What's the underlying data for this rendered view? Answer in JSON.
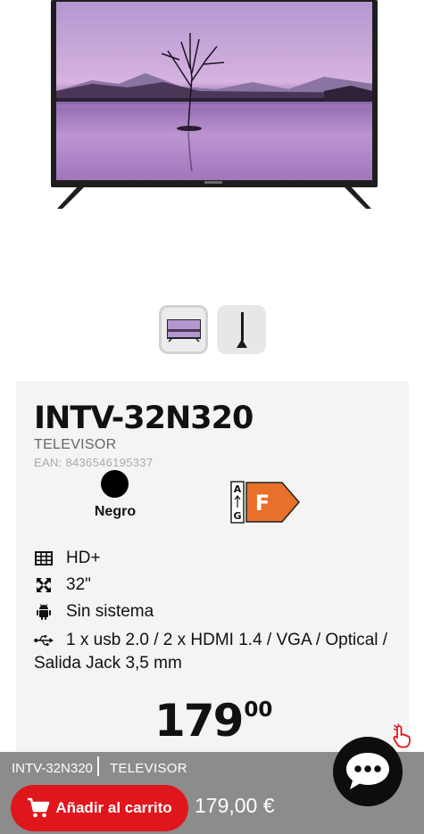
{
  "product": {
    "model": "INTV-32N320",
    "category": "TELEVISOR",
    "ean": "EAN: 8436546195337",
    "color": {
      "label": "Negro",
      "hex": "#000000"
    },
    "energy_class": {
      "top": "A",
      "bottom": "G",
      "grade": "F",
      "color": "#e8702a"
    },
    "specs": [
      {
        "icon": "grid-icon",
        "text": "HD+"
      },
      {
        "icon": "expand-icon",
        "text": "32\""
      },
      {
        "icon": "android-icon",
        "text": "Sin sistema"
      },
      {
        "icon": "usb-icon",
        "text": "1 x usb 2.0 / 2 x HDMI 1.4 / VGA / Optical / Salida Jack 3,5 mm"
      }
    ],
    "price": {
      "integer": "179",
      "decimals": "00"
    }
  },
  "bottom_bar": {
    "model": "INTV-32N320",
    "category": "TELEVISOR",
    "cart_label": "Añadir al carrito",
    "price": "179,00 €",
    "accent": "#e0161d"
  },
  "thumbnails": [
    {
      "icon": "tv-front-thumbnail",
      "selected": true
    },
    {
      "icon": "tv-side-thumbnail",
      "selected": false
    }
  ]
}
